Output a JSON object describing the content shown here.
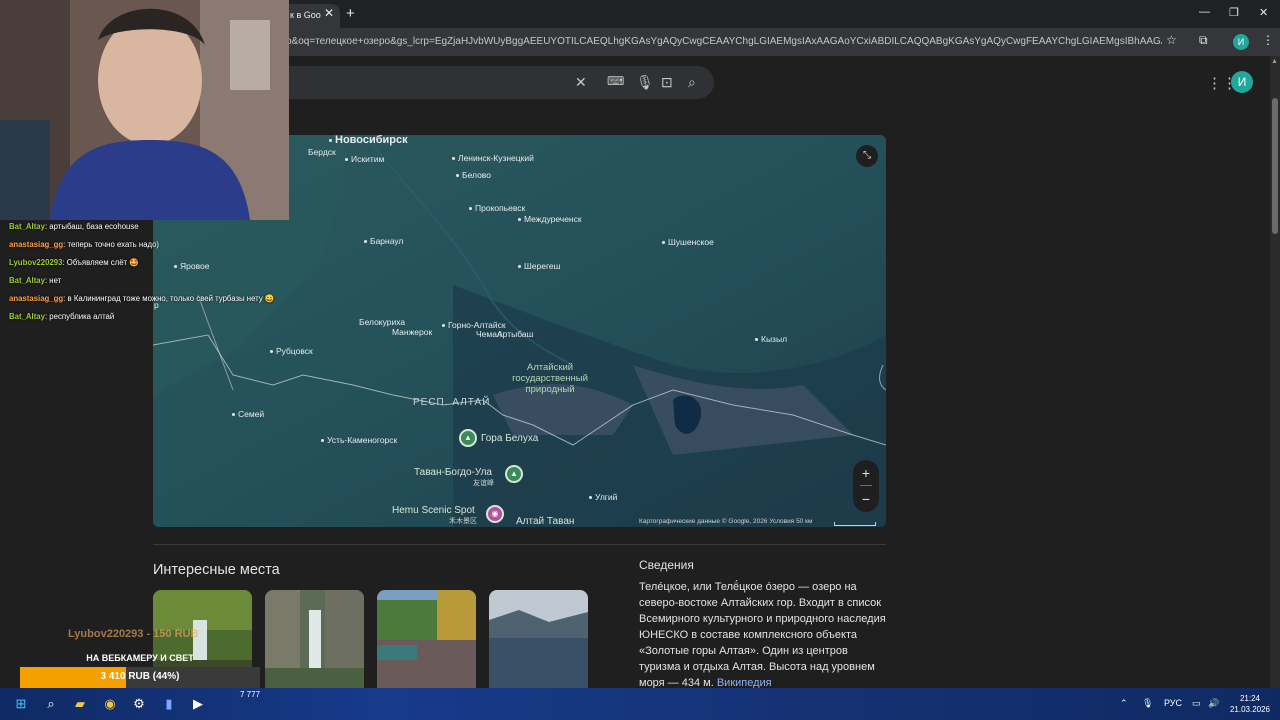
{
  "browser": {
    "tab_title": "к в Goo",
    "url": "o&oq=телецкое+озеро&gs_lcrp=EgZjaHJvbWUyBggAEEUYOTILCAEQLhgKGAsYgAQyCwgCEAAYChgLGIAEMgsIAxAAGAoYCxiABDILCAQQABgKGAsYgAQyCwgFEAAYChgLGIAEMgsIBhAAGAoYCxiABDILCAcQABgKGAsYgAQyCwgIEAAYChgLGIAEMgsICRAAGAoYCxiABDILCAoQABg...",
    "profile_initial": "И"
  },
  "search": {
    "avatar_initial": "И"
  },
  "map": {
    "labels": {
      "novosibirsk": "Новосибирск",
      "berdsk": "Бердск",
      "iskitim": "Искитим",
      "leninsk": "Ленинск-Кузнецкий",
      "belovo": "Белово",
      "prokopyevsk": "Прокопьевск",
      "mezhdurechensk": "Междуреченск",
      "barnaul": "Барнаул",
      "shushenskoe": "Шушенское",
      "yarovoe": "Яровое",
      "sheregesh": "Шерегеш",
      "belokurikha": "Белокуриха",
      "gorno_altaisk": "Горно-Алтайск",
      "manzherok": "Манжерок",
      "chemal": "Чемал",
      "artybash": "Артыбаш",
      "kyzyl": "Кызыл",
      "rubtsovsk": "Рубцовск",
      "park": "Алтайский государственный природный",
      "region": "РЕСП. АЛТАЙ",
      "semey": "Семей",
      "ust_kamenogorsk": "Усть-Каменогорск",
      "belukha": "Гора Белуха",
      "tavan": "Таван-Богдо-Ула",
      "tavan_cn": "友谊峰",
      "hemu": "Hemu Scenic Spot",
      "hemu_cn": "禾木景区",
      "ulgiy": "Улгий",
      "altai_tavan": "Алтай Таван",
      "edge_r": "р"
    },
    "attribution": "Картографические данные © Google, 2026    Условия    50 км"
  },
  "places": {
    "title": "Интересные места"
  },
  "info": {
    "title": "Сведения",
    "body": "Теле́цкое, или Телё́цкое о́зеро — озеро на северо-востоке Алтайских гор. Входит в список Всемирного культурного и природного наследия ЮНЕСКО в составе комплексного объекта «Золотые горы Алтая». Один из центров туризма и отдыха Алтая. Высота над уровнем моря — 434 м.",
    "link": "Википедия"
  },
  "chat": [
    {
      "user": "Bat_Altay",
      "color": "#9acd32",
      "text": ": артыбаш, база ecohouse"
    },
    {
      "user": "anastasiag_gg",
      "color": "#ff9f43",
      "text": ": теперь точно ехать надо)"
    },
    {
      "user": "Lyubov220293",
      "color": "#9acd32",
      "text": ": Объявляем слёт 🤩"
    },
    {
      "user": "Bat_Altay",
      "color": "#9acd32",
      "text": ": нет"
    },
    {
      "user": "anastasiag_gg",
      "color": "#ff9f43",
      "text": ": в Калининград тоже можно, только свей турбазы нету 😄"
    },
    {
      "user": "Bat_Altay",
      "color": "#9acd32",
      "text": ": республика алтай"
    }
  ],
  "donation": {
    "donor": "Lyubov220293 - 150 RUB",
    "goal_title": "НА ВЕБКАМЕРУ И СВЕТ",
    "goal_text": "3 410 RUB (44%)",
    "goal_progress": 0.44
  },
  "taskbar": {
    "counter": "7 777",
    "lang": "РУС",
    "time": "21:24",
    "date": "21.03.2026"
  },
  "colors": {
    "accent": "#1fa89b",
    "link": "#8ab4f8",
    "goal": "#f5a000"
  }
}
